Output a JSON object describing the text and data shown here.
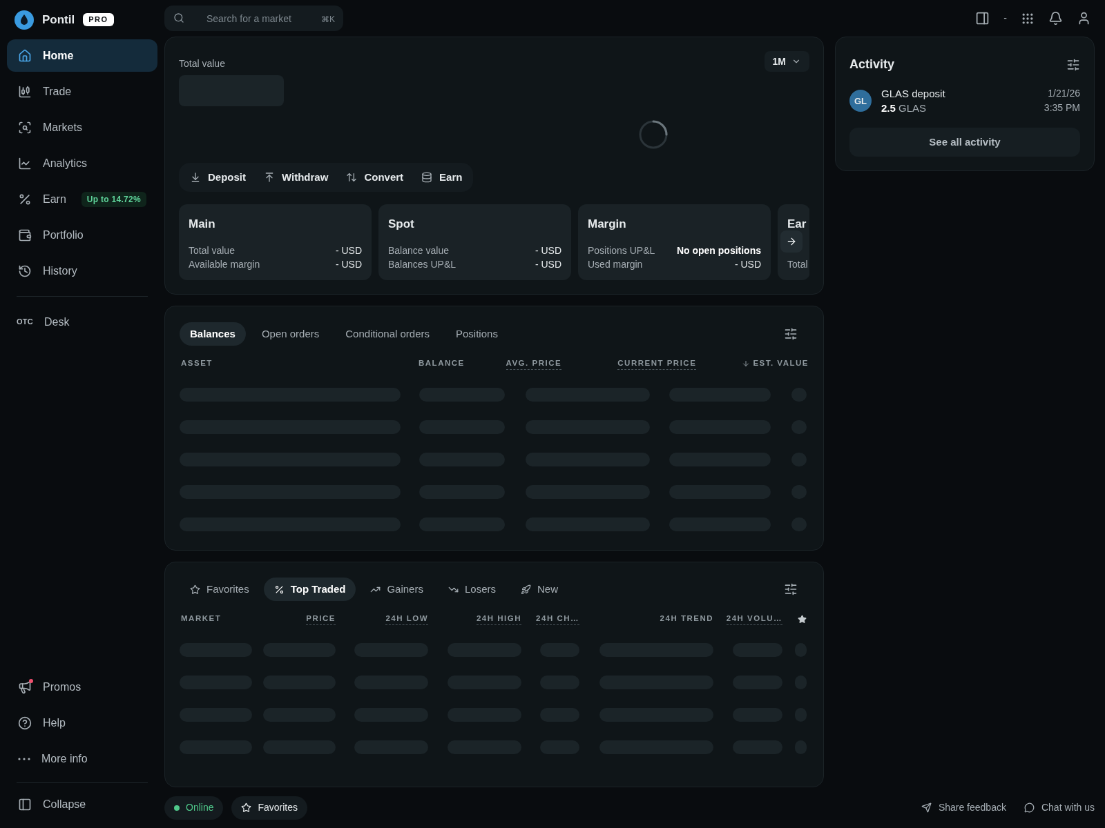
{
  "brand": {
    "name": "Pontil",
    "badge": "PRO"
  },
  "nav": [
    {
      "label": "Home",
      "selected": true
    },
    {
      "label": "Trade",
      "selected": false
    },
    {
      "label": "Markets",
      "selected": false
    },
    {
      "label": "Analytics",
      "selected": false
    },
    {
      "label": "Earn",
      "selected": false,
      "badge": "Up to 14.72%"
    },
    {
      "label": "Portfolio",
      "selected": false
    },
    {
      "label": "History",
      "selected": false
    }
  ],
  "otc": {
    "prefix": "OTC",
    "label": "Desk"
  },
  "nav_bottom": [
    {
      "label": "Promos",
      "dot": true
    },
    {
      "label": "Help",
      "dot": false
    },
    {
      "label": "More info",
      "dot": false
    }
  ],
  "collapse": "Collapse",
  "search": {
    "placeholder": "Search for a market",
    "shortcut": "⌘K"
  },
  "topbar": {
    "separator": "-"
  },
  "overview": {
    "label": "Total value",
    "period": "1M",
    "loading": true,
    "actions": [
      "Deposit",
      "Withdraw",
      "Convert",
      "Earn"
    ],
    "accounts": [
      {
        "title": "Main",
        "rows": [
          {
            "label": "Total value",
            "value": "- USD"
          },
          {
            "label": "Available margin",
            "value": "- USD"
          }
        ]
      },
      {
        "title": "Spot",
        "rows": [
          {
            "label": "Balance value",
            "value": "- USD"
          },
          {
            "label": "Balances UP&L",
            "value": "- USD"
          }
        ]
      },
      {
        "title": "Margin",
        "rows": [
          {
            "label": "Positions UP&L",
            "value": "No open positions",
            "bold": true
          },
          {
            "label": "Used margin",
            "value": "- USD"
          }
        ]
      },
      {
        "title": "Ear",
        "rows": [
          {
            "label": "Total",
            "value": ""
          }
        ]
      }
    ]
  },
  "balances": {
    "tabs": [
      {
        "label": "Balances",
        "selected": true
      },
      {
        "label": "Open orders",
        "selected": false
      },
      {
        "label": "Conditional orders",
        "selected": false
      },
      {
        "label": "Positions",
        "selected": false
      }
    ],
    "columns": [
      {
        "label": "ASSET",
        "dotted": false,
        "sorted": false
      },
      {
        "label": "BALANCE",
        "dotted": false,
        "sorted": false
      },
      {
        "label": "AVG. PRICE",
        "dotted": true,
        "sorted": false
      },
      {
        "label": "CURRENT PRICE",
        "dotted": true,
        "sorted": false
      },
      {
        "label": "EST. VALUE",
        "dotted": false,
        "sorted": true
      }
    ]
  },
  "markets": {
    "tabs": [
      {
        "label": "Favorites",
        "selected": false
      },
      {
        "label": "Top Traded",
        "selected": true
      },
      {
        "label": "Gainers",
        "selected": false
      },
      {
        "label": "Losers",
        "selected": false
      },
      {
        "label": "New",
        "selected": false
      }
    ],
    "columns": [
      {
        "label": "MARKET",
        "dotted": false
      },
      {
        "label": "PRICE",
        "dotted": true
      },
      {
        "label": "24H LOW",
        "dotted": true
      },
      {
        "label": "24H HIGH",
        "dotted": true
      },
      {
        "label": "24H CH…",
        "dotted": true
      },
      {
        "label": "24H TREND",
        "dotted": false
      },
      {
        "label": "24H VOLU…",
        "dotted": true
      },
      {
        "kind": "star"
      }
    ]
  },
  "activity": {
    "title": "Activity",
    "items": [
      {
        "initials": "GL",
        "title": "GLAS deposit",
        "amount": "2.5",
        "unit": "GLAS",
        "date": "1/21/26",
        "time": "3:35 PM"
      }
    ],
    "button": "See all activity"
  },
  "footer": {
    "status": {
      "label": "Online",
      "online": true
    },
    "favorites": "Favorites",
    "links": [
      "Share feedback",
      "Chat with us"
    ]
  }
}
